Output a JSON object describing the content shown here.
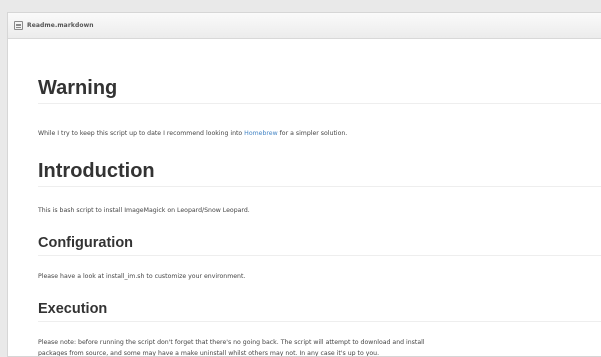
{
  "file_header": {
    "name": "Readme.markdown",
    "icon": "file-text-icon"
  },
  "sections": {
    "warning": {
      "heading": "Warning",
      "text_before": "While I try to keep this script up to date I recommend looking into ",
      "link_text": "Homebrew",
      "text_after": " for a simpler solution."
    },
    "introduction": {
      "heading": "Introduction",
      "text": "This is bash script to install ImageMagick on Leopard/Snow Leopard."
    },
    "configuration": {
      "heading": "Configuration",
      "text": "Please have a look at install_im.sh to customize your environment."
    },
    "execution": {
      "heading": "Execution",
      "line1": "Please note: before running the script don't forget that there's no going back. The script will attempt to download and install",
      "line2": "packages from source, and some may have a make uninstall whilst others may not. In any case it's up to you."
    }
  },
  "colors": {
    "link": "#4183c4",
    "text": "#333333",
    "page_background": "#e9e9e9"
  }
}
